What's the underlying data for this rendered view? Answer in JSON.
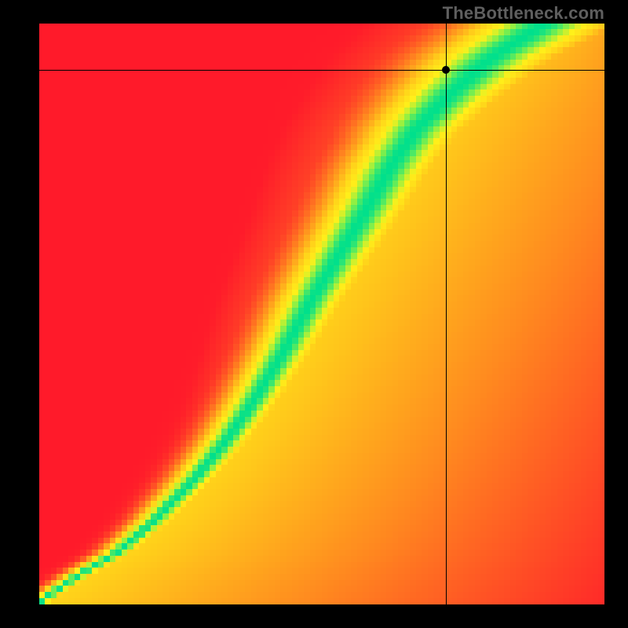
{
  "watermark": "TheBottleneck.com",
  "chart_data": {
    "type": "heatmap",
    "title": "",
    "xlabel": "",
    "ylabel": "",
    "xlim": [
      0,
      1
    ],
    "ylim": [
      0,
      1
    ],
    "grid": false,
    "legend": false,
    "colormap": {
      "name": "red-yellow-green-yellow-orange",
      "stops": [
        {
          "t": 0.0,
          "color": "#FF1A2A"
        },
        {
          "t": 0.35,
          "color": "#FF8A1F"
        },
        {
          "t": 0.6,
          "color": "#FFD21A"
        },
        {
          "t": 0.78,
          "color": "#FFF01A"
        },
        {
          "t": 0.9,
          "color": "#8AF046"
        },
        {
          "t": 1.0,
          "color": "#00E08C"
        }
      ]
    },
    "optimal_ridge": {
      "description": "S-shaped ridge of peak (green) value running from bottom-left corner to top-right quadrant",
      "points": [
        {
          "x": 0.01,
          "y": 0.01
        },
        {
          "x": 0.07,
          "y": 0.05
        },
        {
          "x": 0.14,
          "y": 0.09
        },
        {
          "x": 0.2,
          "y": 0.14
        },
        {
          "x": 0.27,
          "y": 0.21
        },
        {
          "x": 0.33,
          "y": 0.28
        },
        {
          "x": 0.38,
          "y": 0.35
        },
        {
          "x": 0.43,
          "y": 0.43
        },
        {
          "x": 0.48,
          "y": 0.52
        },
        {
          "x": 0.53,
          "y": 0.6
        },
        {
          "x": 0.58,
          "y": 0.68
        },
        {
          "x": 0.62,
          "y": 0.75
        },
        {
          "x": 0.67,
          "y": 0.82
        },
        {
          "x": 0.73,
          "y": 0.88
        },
        {
          "x": 0.8,
          "y": 0.94
        },
        {
          "x": 0.88,
          "y": 0.99
        }
      ],
      "width_profile": [
        {
          "y": 0.02,
          "half_width": 0.015
        },
        {
          "y": 0.2,
          "half_width": 0.025
        },
        {
          "y": 0.5,
          "half_width": 0.04
        },
        {
          "y": 0.8,
          "half_width": 0.055
        },
        {
          "y": 0.98,
          "half_width": 0.08
        }
      ]
    },
    "marker": {
      "x": 0.72,
      "y": 0.92
    },
    "crosshair": {
      "x": 0.72,
      "y": 0.92
    },
    "left_field": {
      "description": "Region left of ridge grades yellow→orange→red moving left",
      "far_value": 0.0
    },
    "right_field": {
      "description": "Region right of ridge grades yellow→orange moving right, redder toward bottom-right",
      "far_value_top": 0.45,
      "far_value_bottom": 0.05
    },
    "pixel_grid": 96
  }
}
